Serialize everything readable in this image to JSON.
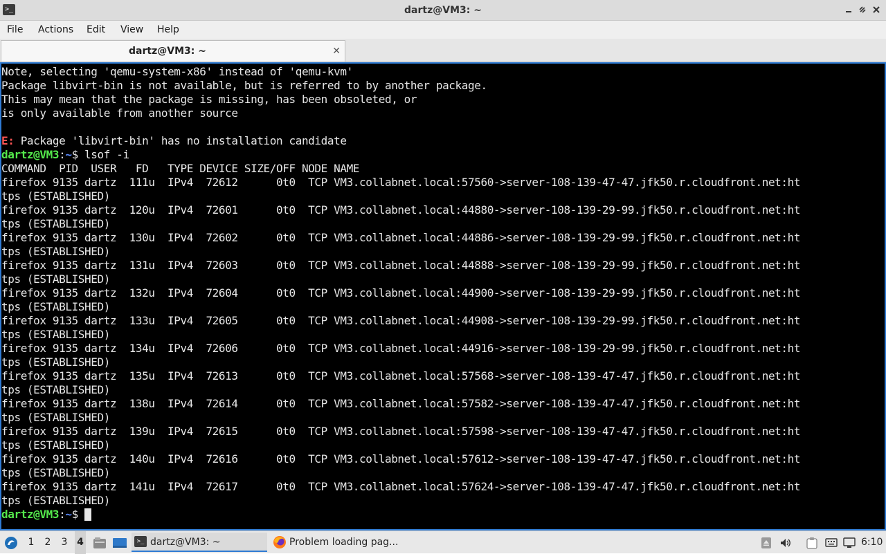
{
  "window": {
    "title": "dartz@VM3: ~",
    "app_icon": "terminal-icon",
    "controls": [
      "minimize",
      "maximize",
      "close"
    ]
  },
  "menu": [
    "File",
    "Actions",
    "Edit",
    "View",
    "Help"
  ],
  "tab": {
    "label": "dartz@VM3: ~",
    "close_glyph": "✕"
  },
  "colors": {
    "terminal_bg": "#000000",
    "terminal_fg": "#e6e6e6",
    "prompt_user": "#54e84c",
    "prompt_path": "#5c8cff",
    "error": "#ff5555",
    "focus_border": "#2f7bd4"
  },
  "terminal": {
    "prompt_user": "dartz@VM3",
    "prompt_sep": ":",
    "prompt_path": "~",
    "prompt_symbol": "$ ",
    "lines": [
      {
        "text": "Note, selecting 'qemu-system-x86' instead of 'qemu-kvm'"
      },
      {
        "text": "Package libvirt-bin is not available, but is referred to by another package."
      },
      {
        "text": "This may mean that the package is missing, has been obsoleted, or"
      },
      {
        "text": "is only available from another source"
      },
      {
        "text": ""
      },
      {
        "error_prefix": "E:",
        "text": " Package 'libvirt-bin' has no installation candidate"
      },
      {
        "prompt": true,
        "text": "lsof -i"
      },
      {
        "text": "COMMAND  PID  USER   FD   TYPE DEVICE SIZE/OFF NODE NAME"
      },
      {
        "text": "firefox 9135 dartz  111u  IPv4  72612      0t0  TCP VM3.collabnet.local:57560->server-108-139-47-47.jfk50.r.cloudfront.net:ht"
      },
      {
        "text": "tps (ESTABLISHED)"
      },
      {
        "text": "firefox 9135 dartz  120u  IPv4  72601      0t0  TCP VM3.collabnet.local:44880->server-108-139-29-99.jfk50.r.cloudfront.net:ht"
      },
      {
        "text": "tps (ESTABLISHED)"
      },
      {
        "text": "firefox 9135 dartz  130u  IPv4  72602      0t0  TCP VM3.collabnet.local:44886->server-108-139-29-99.jfk50.r.cloudfront.net:ht"
      },
      {
        "text": "tps (ESTABLISHED)"
      },
      {
        "text": "firefox 9135 dartz  131u  IPv4  72603      0t0  TCP VM3.collabnet.local:44888->server-108-139-29-99.jfk50.r.cloudfront.net:ht"
      },
      {
        "text": "tps (ESTABLISHED)"
      },
      {
        "text": "firefox 9135 dartz  132u  IPv4  72604      0t0  TCP VM3.collabnet.local:44900->server-108-139-29-99.jfk50.r.cloudfront.net:ht"
      },
      {
        "text": "tps (ESTABLISHED)"
      },
      {
        "text": "firefox 9135 dartz  133u  IPv4  72605      0t0  TCP VM3.collabnet.local:44908->server-108-139-29-99.jfk50.r.cloudfront.net:ht"
      },
      {
        "text": "tps (ESTABLISHED)"
      },
      {
        "text": "firefox 9135 dartz  134u  IPv4  72606      0t0  TCP VM3.collabnet.local:44916->server-108-139-29-99.jfk50.r.cloudfront.net:ht"
      },
      {
        "text": "tps (ESTABLISHED)"
      },
      {
        "text": "firefox 9135 dartz  135u  IPv4  72613      0t0  TCP VM3.collabnet.local:57568->server-108-139-47-47.jfk50.r.cloudfront.net:ht"
      },
      {
        "text": "tps (ESTABLISHED)"
      },
      {
        "text": "firefox 9135 dartz  138u  IPv4  72614      0t0  TCP VM3.collabnet.local:57582->server-108-139-47-47.jfk50.r.cloudfront.net:ht"
      },
      {
        "text": "tps (ESTABLISHED)"
      },
      {
        "text": "firefox 9135 dartz  139u  IPv4  72615      0t0  TCP VM3.collabnet.local:57598->server-108-139-47-47.jfk50.r.cloudfront.net:ht"
      },
      {
        "text": "tps (ESTABLISHED)"
      },
      {
        "text": "firefox 9135 dartz  140u  IPv4  72616      0t0  TCP VM3.collabnet.local:57612->server-108-139-47-47.jfk50.r.cloudfront.net:ht"
      },
      {
        "text": "tps (ESTABLISHED)"
      },
      {
        "text": "firefox 9135 dartz  141u  IPv4  72617      0t0  TCP VM3.collabnet.local:57624->server-108-139-47-47.jfk50.r.cloudfront.net:ht"
      },
      {
        "text": "tps (ESTABLISHED)"
      },
      {
        "prompt": true,
        "text": "",
        "cursor": true
      }
    ]
  },
  "taskbar": {
    "start_icon": "distro-logo-icon",
    "workspaces": [
      "1",
      "2",
      "3",
      "4"
    ],
    "active_workspace": "4",
    "launchers": [
      "file-manager-icon",
      "show-desktop-icon"
    ],
    "tasks": [
      {
        "icon": "terminal-icon",
        "label": "dartz@VM3: ~",
        "active": true
      },
      {
        "icon": "firefox-icon",
        "label": "Problem loading pag...",
        "active": false
      }
    ],
    "tray": [
      "eject-icon",
      "volume-icon",
      "clipboard-icon",
      "keyboard-icon",
      "network-icon"
    ],
    "clock": "6:10"
  }
}
